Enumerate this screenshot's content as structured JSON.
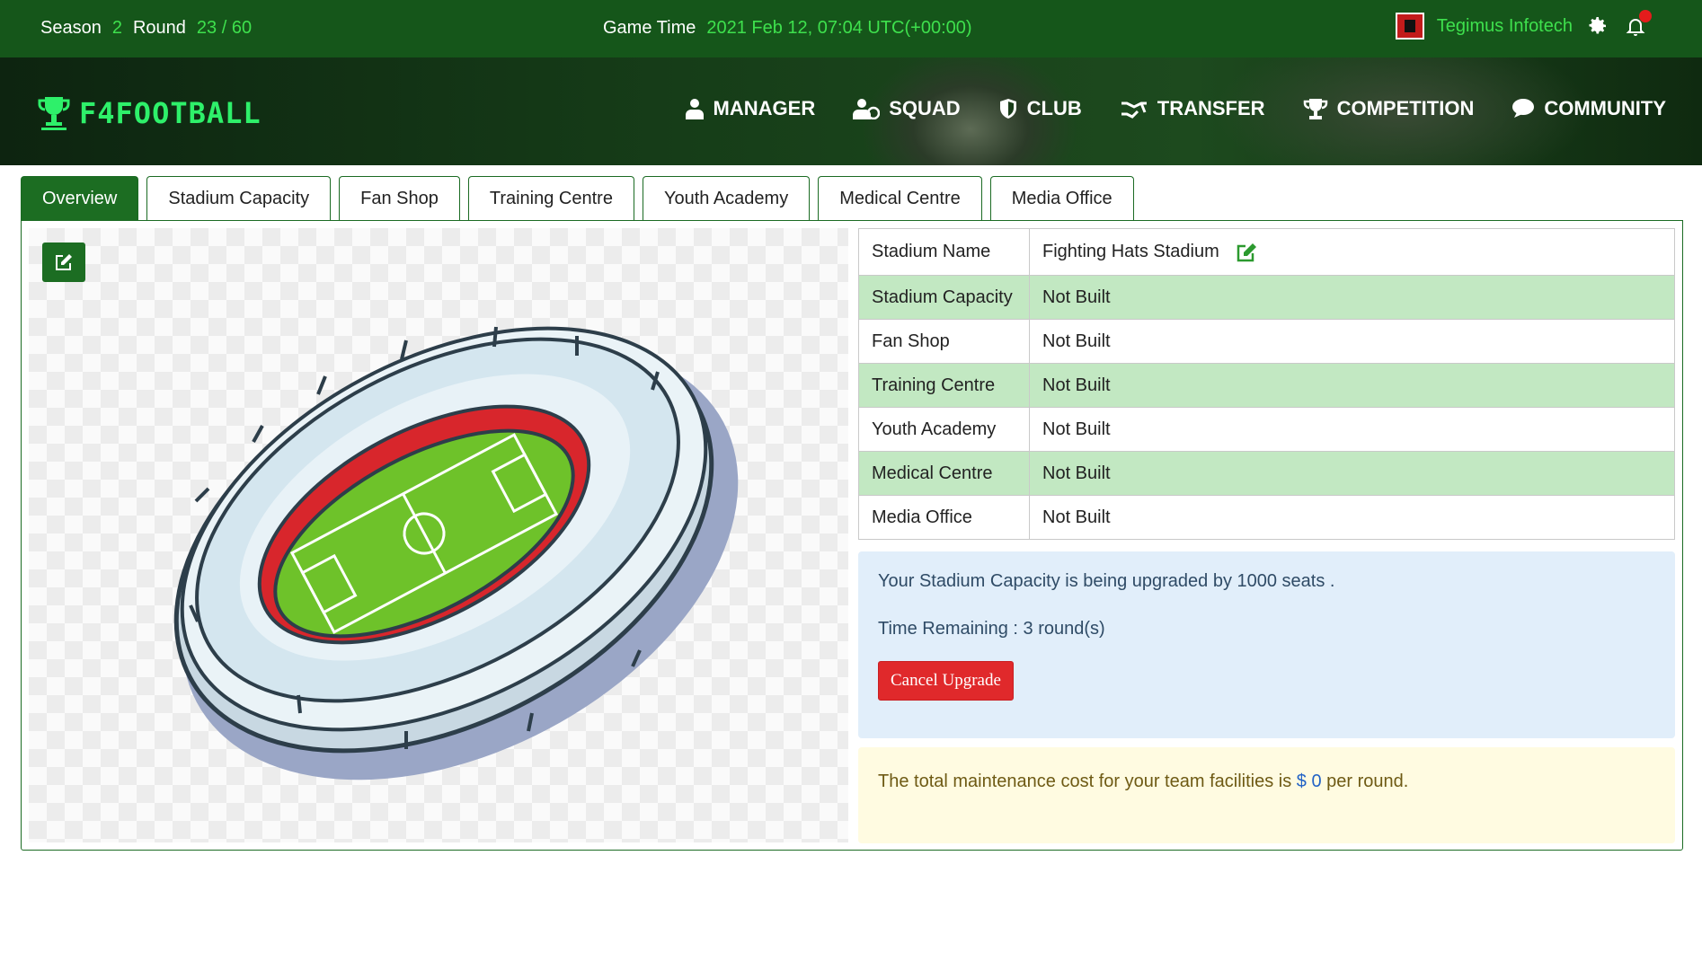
{
  "topbar": {
    "season_label": "Season",
    "season_value": "2",
    "round_label": "Round",
    "round_value": "23 / 60",
    "game_time_label": "Game Time",
    "game_time_value": "2021 Feb 12, 07:04 UTC(+00:00)",
    "club_name": "Tegimus Infotech",
    "icons": [
      "club-flag-icon",
      "gear-icon",
      "bell-icon"
    ]
  },
  "brand": {
    "logo_text": "F4FOOTBALL"
  },
  "nav": {
    "items": [
      {
        "label": "MANAGER",
        "icon": "manager-icon"
      },
      {
        "label": "SQUAD",
        "icon": "squad-icon"
      },
      {
        "label": "CLUB",
        "icon": "shield-icon"
      },
      {
        "label": "TRANSFER",
        "icon": "handshake-icon"
      },
      {
        "label": "COMPETITION",
        "icon": "trophy-icon"
      },
      {
        "label": "COMMUNITY",
        "icon": "chat-bubble-icon"
      }
    ]
  },
  "tabs": [
    {
      "label": "Overview",
      "active": true
    },
    {
      "label": "Stadium Capacity"
    },
    {
      "label": "Fan Shop"
    },
    {
      "label": "Training Centre"
    },
    {
      "label": "Youth Academy"
    },
    {
      "label": "Medical Centre"
    },
    {
      "label": "Media Office"
    }
  ],
  "facilities": {
    "rows": [
      {
        "key": "Stadium Name",
        "value": "Fighting Hats Stadium"
      },
      {
        "key": "Stadium Capacity",
        "value": "Not Built"
      },
      {
        "key": "Fan Shop",
        "value": "Not Built"
      },
      {
        "key": "Training Centre",
        "value": "Not Built"
      },
      {
        "key": "Youth Academy",
        "value": "Not Built"
      },
      {
        "key": "Medical Centre",
        "value": "Not Built"
      },
      {
        "key": "Media Office",
        "value": "Not Built"
      }
    ]
  },
  "upgrade": {
    "message": "Your Stadium Capacity is being upgraded by 1000 seats .",
    "time_remaining": "Time Remaining : 3 round(s)",
    "cancel_label": "Cancel Upgrade"
  },
  "maintenance": {
    "prefix": "The total maintenance cost for your team facilities is",
    "amount": "$ 0",
    "suffix": "per round."
  },
  "colors": {
    "topbar_bg": "#15561a",
    "accent_green": "#3ee04d",
    "tab_active": "#1c6d22",
    "row_alt": "#c2e8c2",
    "cancel_red": "#e0292b"
  }
}
